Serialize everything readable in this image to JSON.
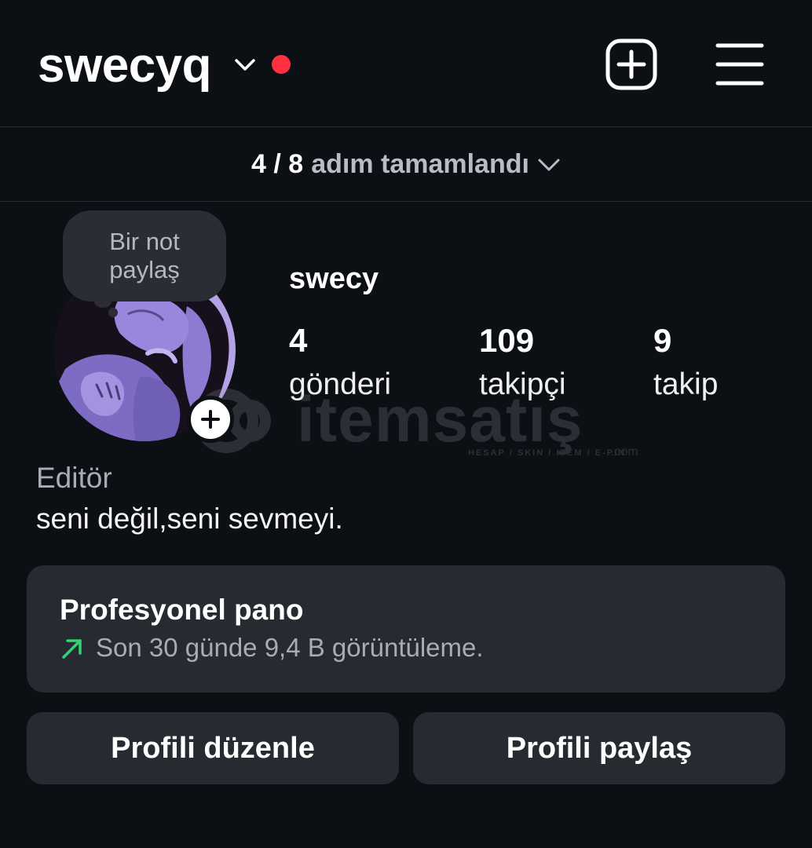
{
  "header": {
    "username": "swecyq",
    "has_notification_dot": true,
    "notification_color": "#ff3040"
  },
  "steps": {
    "count": "4 / 8",
    "label": "adım tamamlandı"
  },
  "note": {
    "line1": "Bir not",
    "line2": "paylaş"
  },
  "profile": {
    "display_name": "swecy",
    "stats": [
      {
        "value": "4",
        "label": "gönderi"
      },
      {
        "value": "109",
        "label": "takipçi"
      },
      {
        "value": "9",
        "label": "takip"
      }
    ],
    "category": "Editör",
    "bio": "seni değil,seni sevmeyi."
  },
  "watermark": {
    "brand": "itemsatış",
    "tagline": "HESAP / SKIN / ITEM / E-PIN",
    "suffix": ".com"
  },
  "dashboard": {
    "title": "Profesyonel pano",
    "subtitle": "Son 30 günde 9,4 B görüntüleme.",
    "trend_color": "#2fd573"
  },
  "buttons": {
    "edit": "Profili düzenle",
    "share": "Profili paylaş"
  }
}
